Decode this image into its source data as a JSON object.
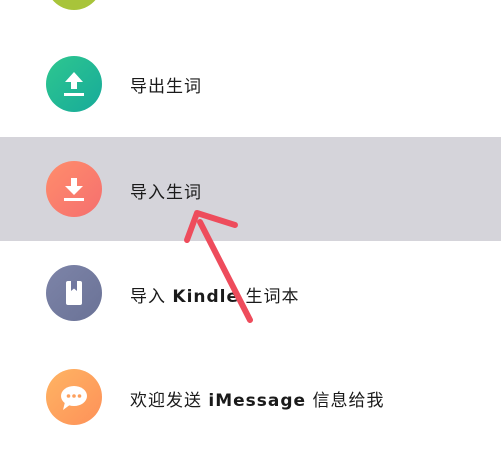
{
  "menu": {
    "items": [
      {
        "label": "导出生词",
        "icon": "upload-icon",
        "color_start": "#2ec78f",
        "color_end": "#17aa9a"
      },
      {
        "label": "导入生词",
        "icon": "download-icon",
        "color_start": "#ff8d6b",
        "color_end": "#f56f6f",
        "selected": true
      },
      {
        "label_prefix": "导入 ",
        "label_bold": "Kindle",
        "label_suffix": " 生词本",
        "icon": "book-icon",
        "color_start": "#7d84a8",
        "color_end": "#6a7296"
      },
      {
        "label_prefix": "欢迎发送 ",
        "label_bold": "iMessage",
        "label_suffix": " 信息给我",
        "icon": "chat-bubble-icon",
        "color_start": "#ffb463",
        "color_end": "#fd9159"
      }
    ]
  },
  "annotation": {
    "type": "arrow-icon",
    "color": "#ee4c5c"
  },
  "colors": {
    "highlight": "#d5d4da",
    "top_icon": "#a8c43a"
  }
}
